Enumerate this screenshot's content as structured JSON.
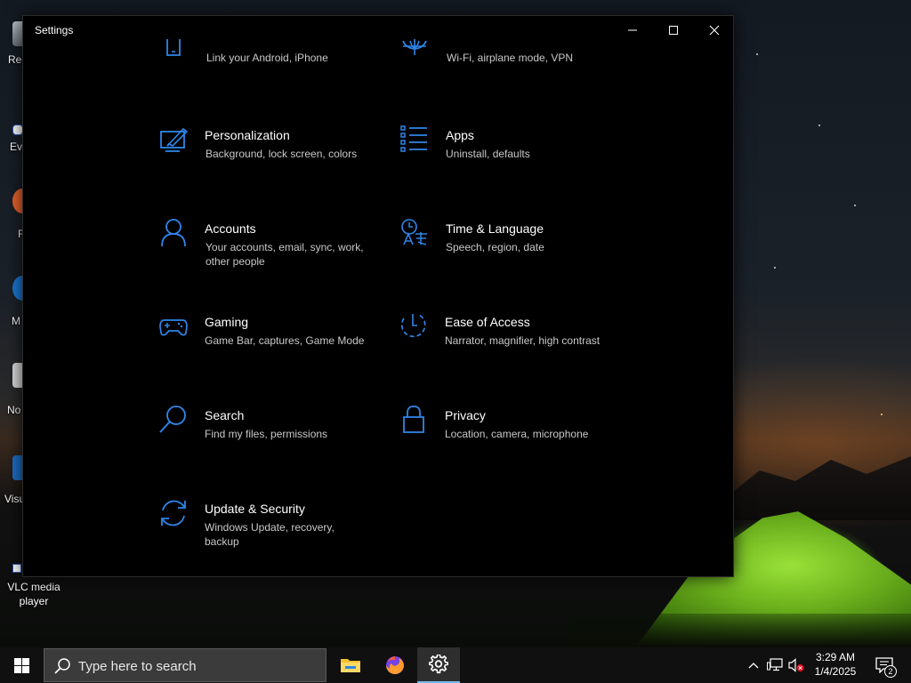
{
  "window": {
    "title": "Settings"
  },
  "categories": [
    {
      "name": "",
      "description": "Link your Android, iPhone",
      "icon": "phone-icon"
    },
    {
      "name": "",
      "description": "Wi-Fi, airplane mode, VPN",
      "icon": "globe-icon"
    },
    {
      "name": "Personalization",
      "description": "Background, lock screen, colors",
      "icon": "personalization-icon"
    },
    {
      "name": "Apps",
      "description": "Uninstall, defaults",
      "icon": "apps-list-icon"
    },
    {
      "name": "Accounts",
      "description": "Your accounts, email, sync, work, other people",
      "icon": "person-icon"
    },
    {
      "name": "Time & Language",
      "description": "Speech, region, date",
      "icon": "time-language-icon"
    },
    {
      "name": "Gaming",
      "description": "Game Bar, captures, Game Mode",
      "icon": "gamepad-icon"
    },
    {
      "name": "Ease of Access",
      "description": "Narrator, magnifier, high contrast",
      "icon": "ease-of-access-icon"
    },
    {
      "name": "Search",
      "description": "Find my files, permissions",
      "icon": "search-icon"
    },
    {
      "name": "Privacy",
      "description": "Location, camera, microphone",
      "icon": "lock-icon"
    },
    {
      "name": "Update & Security",
      "description": "Windows Update, recovery, backup",
      "icon": "update-sync-icon"
    }
  ],
  "desktop": {
    "icons": [
      {
        "label": "Rec"
      },
      {
        "label": "Eve"
      },
      {
        "label": "F"
      },
      {
        "label": "M"
      },
      {
        "label": "No"
      },
      {
        "label": "Visu"
      }
    ],
    "vlc_label": "VLC media player"
  },
  "taskbar": {
    "search_placeholder": "Type here to search",
    "apps": [
      "file-explorer-icon",
      "firefox-icon",
      "settings-gear-icon"
    ],
    "clock_time": "3:29 AM",
    "clock_date": "1/4/2025",
    "notification_count": "2"
  },
  "theme": {
    "accent": "#2f86e8",
    "window_bg": "#000000",
    "taskbar_bg": "#101010",
    "search_bg": "#3b3b3b"
  }
}
